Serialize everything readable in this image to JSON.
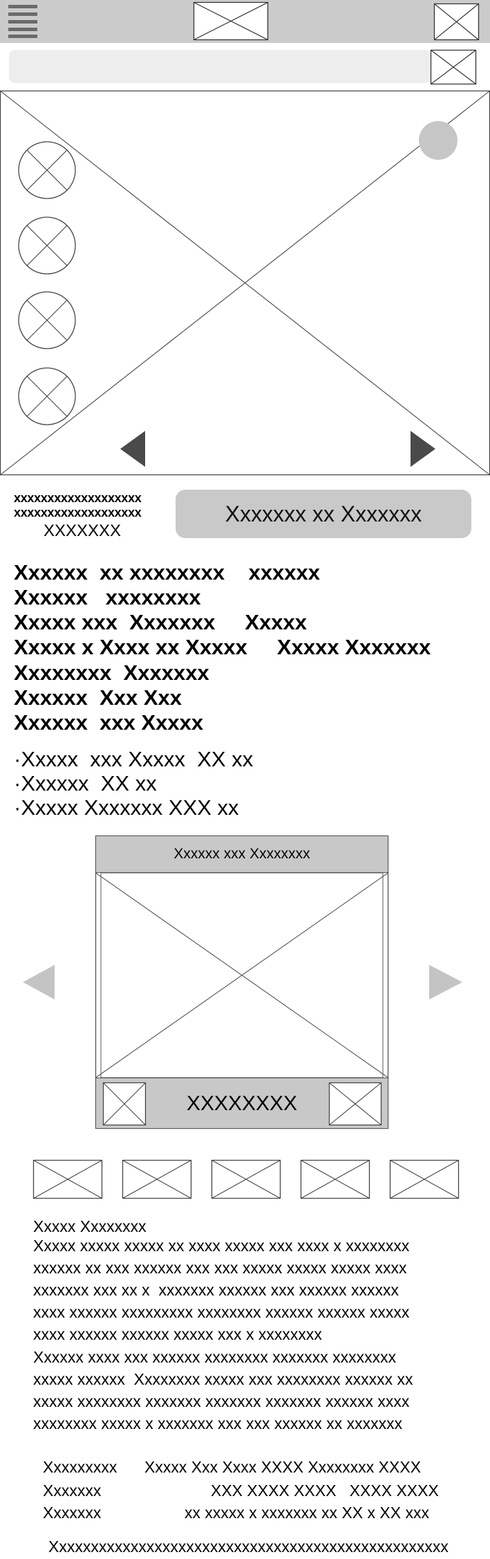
{
  "search": {
    "placeholder": ""
  },
  "product": {
    "code_lines": [
      "xxxxxxxxxxxxxxxxxxx",
      "xxxxxxxxxxxxxxxxxxx",
      "XXXXXXX"
    ],
    "cta_label": "Xxxxxxx xx Xxxxxxx",
    "spec_lines": [
      "Xxxxxx  xx xxxxxxxx    xxxxxx",
      "Xxxxxx   xxxxxxxx",
      "Xxxxx xxx  Xxxxxxx     Xxxxx",
      "Xxxxx x Xxxx xx Xxxxx     Xxxxx Xxxxxxx",
      "Xxxxxxxx  Xxxxxxx",
      "Xxxxxx  Xxx Xxx",
      "Xxxxxx  xxx Xxxxx"
    ],
    "bullets": [
      "·Xxxxx  xxx Xxxxx  XX xx",
      "·Xxxxxx  XX xx",
      "·Xxxxx Xxxxxxx XXX xx"
    ]
  },
  "carousel": {
    "header": "Xxxxxx xxx Xxxxxxxx",
    "footer": "XXXXXXXX"
  },
  "description": {
    "title": "Xxxxx Xxxxxxxx",
    "lines": [
      "Xxxxx xxxxx xxxxx xx xxxx xxxxx xxx xxxx x xxxxxxxx",
      "xxxxxx xx xxx xxxxxx xxx xxx xxxxx xxxxx xxxxx xxxx",
      "xxxxxxx xxx xx x  xxxxxxx xxxxxx xxx xxxxxx xxxxxx",
      "xxxx xxxxxx xxxxxxxxx xxxxxxxx xxxxxx xxxxxx xxxxx",
      "xxxx xxxxxx xxxxxx xxxxx xxx x xxxxxxxx",
      "Xxxxxx xxxx xxx xxxxxx xxxxxxxx xxxxxxx xxxxxxxx",
      "xxxxx xxxxxx  Xxxxxxxx xxxxx xxx xxxxxxxx xxxxxx xx",
      "xxxxx xxxxxxxx xxxxxxx xxxxxxx xxxxxxx xxxxxx xxxx",
      "xxxxxxxx xxxxx x xxxxxxx xxx xxx xxxxxx xx xxxxxxx"
    ]
  },
  "spec_table": [
    {
      "label": "Xxxxxxxxx",
      "value": "Xxxxx Xxx Xxxx XXXX Xxxxxxxx XXXX"
    },
    {
      "label": "Xxxxxxx",
      "value": "XXX XXXX XXXX   XXXX XXXX"
    },
    {
      "label": "Xxxxxxx",
      "value": "xx xxxxx x xxxxxxx xx XX x XX xxx"
    }
  ],
  "footer": {
    "text": "Xxxxxxxxxxxxxxxxxxxxxxxxxxxxxxxxxxxxxxxxxxxxxxxxxx"
  }
}
